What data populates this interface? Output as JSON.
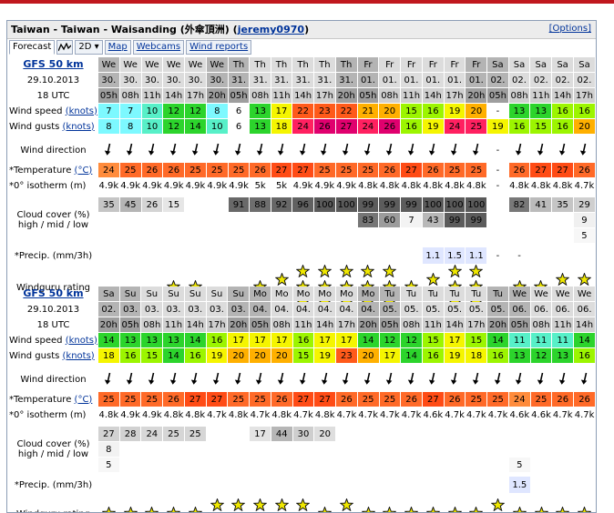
{
  "title": {
    "place": "Taiwan - Taiwan - Waisanding (外傘頂洲)",
    "user": "jeremy0970",
    "open_paren": "(",
    "close_paren": ")",
    "options": "[Options]"
  },
  "tabs": [
    {
      "label": "Forecast"
    },
    {
      "label": "2D ▾"
    },
    {
      "label": "Map"
    },
    {
      "label": "Webcams"
    },
    {
      "label": "Wind reports"
    }
  ],
  "labels": {
    "wind_speed": "Wind speed",
    "wind_gusts": "Wind gusts",
    "knots": "(knots)",
    "wind_direction": "Wind direction",
    "temperature": "*Temperature",
    "celsius": "(°C)",
    "isotherm": "*0° isotherm (m)",
    "cloud_cover": "Cloud cover (%)",
    "cloud_layers": "high / mid / low",
    "precip": "*Precip. (mm/3h)",
    "rating": "Windguru rating"
  },
  "icons": {
    "chart_tab": "line-chart-icon",
    "direction": "wind-arrow-icon",
    "rating": "star-icon"
  },
  "colors": {
    "night_header": "#9e9e9e",
    "day_header": "#cfcfcf",
    "star": "#f0e800",
    "link": "#00339a",
    "accent": "#c0171e"
  },
  "blocks": [
    {
      "model": "GFS 50 km",
      "date": "29.10.2013",
      "utc": "18 UTC",
      "days": [
        "We",
        "We",
        "We",
        "We",
        "We",
        "We",
        "Th",
        "Th",
        "Th",
        "Th",
        "Th",
        "Th",
        "Fr",
        "Fr",
        "Fr",
        "Fr",
        "Fr",
        "Fr",
        "Sa",
        "Sa",
        "Sa",
        "Sa",
        "Sa"
      ],
      "dates": [
        "30.",
        "30.",
        "30.",
        "30.",
        "30.",
        "30.",
        "31.",
        "31.",
        "31.",
        "31.",
        "31.",
        "31.",
        "01.",
        "01.",
        "01.",
        "01.",
        "01.",
        "01.",
        "02.",
        "02.",
        "02.",
        "02.",
        "02."
      ],
      "hours": [
        "05h",
        "08h",
        "11h",
        "14h",
        "17h",
        "20h",
        "05h",
        "08h",
        "11h",
        "14h",
        "17h",
        "20h",
        "05h",
        "08h",
        "11h",
        "14h",
        "17h",
        "20h",
        "05h",
        "08h",
        "11h",
        "14h",
        "17h"
      ],
      "night": [
        1,
        0,
        0,
        0,
        0,
        1,
        1,
        0,
        0,
        0,
        0,
        1,
        1,
        0,
        0,
        0,
        0,
        1,
        1,
        0,
        0,
        0,
        0
      ],
      "wind_speed": [
        "7",
        "7",
        "10",
        "12",
        "12",
        "8",
        "6",
        "13",
        "17",
        "22",
        "23",
        "22",
        "21",
        "20",
        "15",
        "16",
        "19",
        "20",
        "-",
        "13",
        "13",
        "16",
        "16"
      ],
      "wind_gusts": [
        "8",
        "8",
        "10",
        "12",
        "14",
        "10",
        "6",
        "13",
        "18",
        "24",
        "26",
        "27",
        "24",
        "26",
        "16",
        "19",
        "24",
        "25",
        "19",
        "16",
        "15",
        "16",
        "20"
      ],
      "direction": [
        20,
        20,
        20,
        20,
        20,
        20,
        20,
        20,
        20,
        20,
        20,
        20,
        20,
        20,
        20,
        20,
        20,
        20,
        null,
        20,
        20,
        20,
        20
      ],
      "temperature": [
        "24",
        "25",
        "26",
        "26",
        "25",
        "25",
        "25",
        "26",
        "27",
        "27",
        "25",
        "25",
        "25",
        "26",
        "27",
        "26",
        "25",
        "25",
        "-",
        "26",
        "27",
        "27",
        "26"
      ],
      "isotherm": [
        "4.9k",
        "4.9k",
        "4.9k",
        "4.9k",
        "4.9k",
        "4.9k",
        "4.9k",
        "5k",
        "5k",
        "4.9k",
        "4.9k",
        "4.9k",
        "4.8k",
        "4.8k",
        "4.8k",
        "4.8k",
        "4.8k",
        "4.8k",
        "-",
        "4.8k",
        "4.8k",
        "4.8k",
        "4.7k"
      ],
      "cloud_high": [
        "35",
        "45",
        "26",
        "15",
        "",
        "",
        "91",
        "88",
        "92",
        "96",
        "100",
        "100",
        "99",
        "99",
        "99",
        "100",
        "100",
        "100",
        "",
        "82",
        "41",
        "35",
        "29"
      ],
      "cloud_mid": [
        "",
        "",
        "",
        "",
        "",
        "",
        "",
        "",
        "",
        "",
        "",
        "",
        "83",
        "60",
        "7",
        "43",
        "99",
        "99",
        "",
        "",
        "",
        "",
        "9"
      ],
      "cloud_low": [
        "",
        "",
        "",
        "",
        "",
        "",
        "",
        "",
        "",
        "",
        "",
        "",
        "",
        "",
        "",
        "",
        "",
        "",
        "",
        "",
        "",
        "",
        "5"
      ],
      "precip": [
        "",
        "",
        "",
        "",
        "",
        "",
        "",
        "",
        "",
        "",
        "",
        "",
        "",
        "",
        "",
        "1.1",
        "1.5",
        "1.1",
        "-",
        "-",
        "",
        "",
        ""
      ],
      "rating": [
        0,
        0,
        0,
        1,
        1,
        0,
        0,
        1,
        2,
        3,
        3,
        3,
        3,
        3,
        1,
        2,
        3,
        3,
        0,
        1,
        1,
        2,
        2
      ]
    },
    {
      "model": "GFS 50 km",
      "date": "29.10.2013",
      "utc": "18 UTC",
      "days": [
        "Sa",
        "Su",
        "Su",
        "Su",
        "Su",
        "Su",
        "Su",
        "Mo",
        "Mo",
        "Mo",
        "Mo",
        "Mo",
        "Mo",
        "Tu",
        "Tu",
        "Tu",
        "Tu",
        "Tu",
        "Tu",
        "We",
        "We",
        "We",
        "We"
      ],
      "dates": [
        "02.",
        "03.",
        "03.",
        "03.",
        "03.",
        "03.",
        "03.",
        "04.",
        "04.",
        "04.",
        "04.",
        "04.",
        "04.",
        "05.",
        "05.",
        "05.",
        "05.",
        "05.",
        "05.",
        "06.",
        "06.",
        "06.",
        "06."
      ],
      "hours": [
        "20h",
        "05h",
        "08h",
        "11h",
        "14h",
        "17h",
        "20h",
        "05h",
        "08h",
        "11h",
        "14h",
        "17h",
        "20h",
        "05h",
        "08h",
        "11h",
        "14h",
        "17h",
        "20h",
        "05h",
        "08h",
        "11h",
        "14h"
      ],
      "night": [
        1,
        1,
        0,
        0,
        0,
        0,
        1,
        1,
        0,
        0,
        0,
        0,
        1,
        1,
        0,
        0,
        0,
        0,
        1,
        1,
        0,
        0,
        0
      ],
      "wind_speed": [
        "14",
        "13",
        "13",
        "13",
        "14",
        "16",
        "17",
        "17",
        "17",
        "16",
        "17",
        "17",
        "14",
        "12",
        "12",
        "15",
        "17",
        "15",
        "14",
        "11",
        "11",
        "11",
        "14"
      ],
      "wind_gusts": [
        "18",
        "16",
        "15",
        "14",
        "16",
        "19",
        "20",
        "20",
        "20",
        "15",
        "19",
        "23",
        "20",
        "17",
        "14",
        "16",
        "19",
        "18",
        "16",
        "13",
        "12",
        "13",
        "16"
      ],
      "direction": [
        20,
        20,
        20,
        20,
        20,
        20,
        20,
        20,
        20,
        20,
        20,
        20,
        20,
        20,
        20,
        20,
        20,
        20,
        20,
        20,
        20,
        20,
        20
      ],
      "temperature": [
        "25",
        "25",
        "25",
        "26",
        "27",
        "27",
        "25",
        "25",
        "26",
        "27",
        "27",
        "26",
        "25",
        "25",
        "26",
        "27",
        "26",
        "25",
        "25",
        "24",
        "25",
        "26",
        "26"
      ],
      "isotherm": [
        "4.8k",
        "4.9k",
        "4.9k",
        "4.8k",
        "4.8k",
        "4.7k",
        "4.8k",
        "4.7k",
        "4.8k",
        "4.7k",
        "4.8k",
        "4.7k",
        "4.7k",
        "4.7k",
        "4.7k",
        "4.6k",
        "4.7k",
        "4.7k",
        "4.7k",
        "4.6k",
        "4.6k",
        "4.7k",
        "4.7k"
      ],
      "cloud_high": [
        "27",
        "28",
        "24",
        "25",
        "25",
        "",
        "",
        "17",
        "44",
        "30",
        "20",
        "",
        "",
        "",
        "",
        "",
        "",
        "",
        "",
        "",
        "",
        "",
        ""
      ],
      "cloud_mid": [
        "8",
        "",
        "",
        "",
        "",
        "",
        "",
        "",
        "",
        "",
        "",
        "",
        "",
        "",
        "",
        "",
        "",
        "",
        "",
        "",
        "",
        "",
        ""
      ],
      "cloud_low": [
        "5",
        "",
        "",
        "",
        "",
        "",
        "",
        "",
        "",
        "",
        "",
        "",
        "",
        "",
        "",
        "",
        "",
        "",
        "",
        "5",
        "",
        "",
        ""
      ],
      "precip": [
        "",
        "",
        "",
        "",
        "",
        "",
        "",
        "",
        "",
        "",
        "",
        "",
        "",
        "",
        "",
        "",
        "",
        "",
        "",
        "1.5",
        "",
        "",
        ""
      ],
      "rating": [
        1,
        1,
        1,
        1,
        1,
        2,
        2,
        2,
        2,
        2,
        1,
        2,
        1,
        1,
        1,
        1,
        1,
        1,
        2,
        1,
        1,
        1,
        1
      ]
    }
  ]
}
